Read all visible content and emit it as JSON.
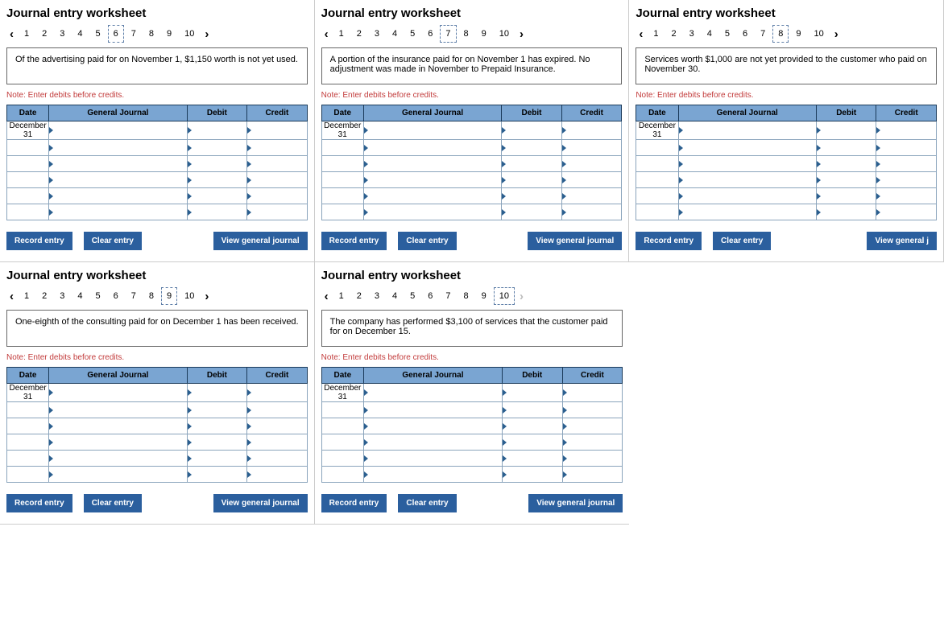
{
  "shared": {
    "title": "Journal entry worksheet",
    "note": "Note: Enter debits before credits.",
    "headers": {
      "date": "Date",
      "gj": "General Journal",
      "debit": "Debit",
      "credit": "Credit"
    },
    "buttons": {
      "record": "Record entry",
      "clear": "Clear entry",
      "view": "View general journal",
      "view_short": "View general j"
    },
    "arrows": {
      "prev": "‹",
      "next": "›"
    },
    "tabs": [
      "1",
      "2",
      "3",
      "4",
      "5",
      "6",
      "7",
      "8",
      "9",
      "10"
    ],
    "default_date": "December 31"
  },
  "panels": [
    {
      "selected_tab": "6",
      "prompt": "Of the advertising paid for on November 1, $1,150 worth is not yet used.",
      "next_disabled": false,
      "truncated_view": false
    },
    {
      "selected_tab": "7",
      "prompt": "A portion of the insurance paid for on November 1 has expired. No adjustment was made in November to Prepaid Insurance.",
      "next_disabled": false,
      "truncated_view": false
    },
    {
      "selected_tab": "8",
      "prompt": "Services worth $1,000 are not yet provided to the customer who paid on November 30.",
      "next_disabled": false,
      "truncated_view": true
    },
    {
      "selected_tab": "9",
      "prompt": "One-eighth of the consulting paid for on December 1 has been received.",
      "next_disabled": false,
      "truncated_view": false
    },
    {
      "selected_tab": "10",
      "prompt": "The company has performed $3,100 of services that the customer paid for on December 15.",
      "next_disabled": true,
      "truncated_view": false
    }
  ]
}
